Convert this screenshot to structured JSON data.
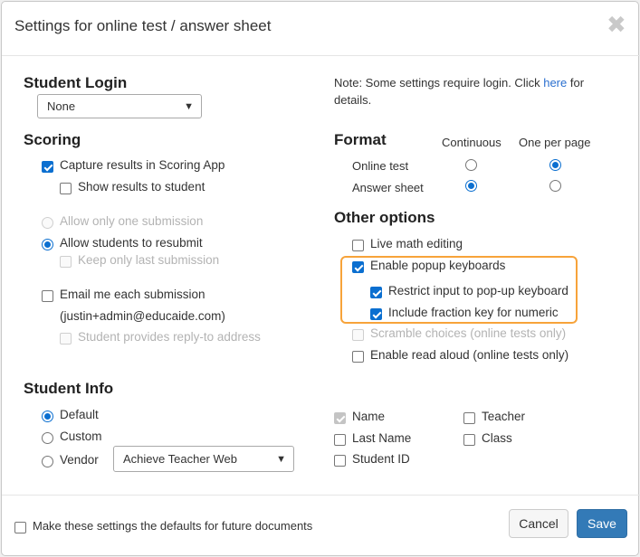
{
  "dialog": {
    "title": "Settings for online test / answer sheet",
    "close_glyph": "✖"
  },
  "student_login": {
    "heading": "Student Login",
    "select_value": "None"
  },
  "note": {
    "line1_prefix": "Note: Some settings require login. Click ",
    "link": "here",
    "line1_suffix": " for",
    "line2": "details."
  },
  "scoring": {
    "heading": "Scoring",
    "capture": "Capture results in Scoring App",
    "show_results": "Show results to student",
    "allow_one": "Allow only one submission",
    "allow_resubmit": "Allow students to resubmit",
    "keep_last": "Keep only last submission",
    "email_me": "Email me each submission",
    "email_address": "(justin+admin@educaide.com)",
    "reply_to": "Student provides reply-to address"
  },
  "format": {
    "heading": "Format",
    "col_continuous": "Continuous",
    "col_one_per_page": "One per page",
    "row_online": "Online test",
    "row_answer": "Answer sheet"
  },
  "other_options": {
    "heading": "Other options",
    "live_math": "Live math editing",
    "popup_keyboards": "Enable popup keyboards",
    "restrict_input": "Restrict input to pop-up keyboard",
    "fraction_key": "Include fraction key for numeric",
    "scramble": "Scramble choices (online tests only)",
    "read_aloud": "Enable read aloud (online tests only)"
  },
  "student_info": {
    "heading": "Student Info",
    "default": "Default",
    "custom": "Custom",
    "vendor": "Vendor",
    "vendor_select": "Achieve Teacher Web",
    "fields": {
      "name": "Name",
      "teacher": "Teacher",
      "last_name": "Last Name",
      "class": "Class",
      "student_id": "Student ID"
    }
  },
  "footer": {
    "defaults_label": "Make these settings the defaults for future documents",
    "cancel": "Cancel",
    "save": "Save"
  },
  "colors": {
    "accent": "#0b6fd0",
    "save_button": "#337ab7",
    "highlight_border": "#f7a33a",
    "link": "#2a6fcf"
  }
}
